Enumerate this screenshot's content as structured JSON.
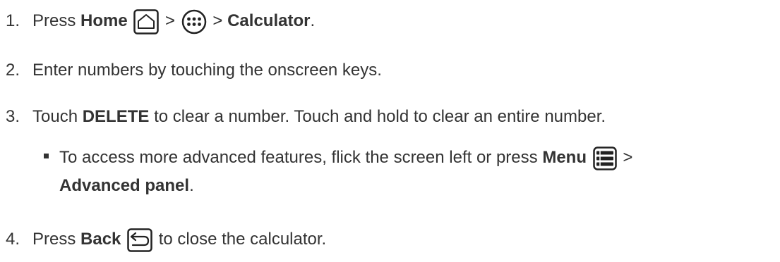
{
  "steps": [
    {
      "number": "1.",
      "text_press": "Press ",
      "home": "Home",
      "gt1": " > ",
      "gt2": " > ",
      "calculator": "Calculator",
      "period": "."
    },
    {
      "number": "2.",
      "text": "Enter numbers by touching the onscreen keys."
    },
    {
      "number": "3.",
      "text_touch": "Touch ",
      "delete": "DELETE",
      "rest": " to clear a number. Touch and hold to clear an entire number."
    },
    {
      "number": "4.",
      "text_press": "Press ",
      "back": "Back",
      "rest": " to close the calculator."
    }
  ],
  "note": {
    "line1_text": "To access more advanced features, flick the screen left or press ",
    "menu": "Menu",
    "gt": " >",
    "advanced_panel": "Advanced panel",
    "period": "."
  },
  "icons": {
    "home": "home-icon",
    "apps": "apps-icon",
    "menu": "menu-icon",
    "back": "back-icon"
  }
}
